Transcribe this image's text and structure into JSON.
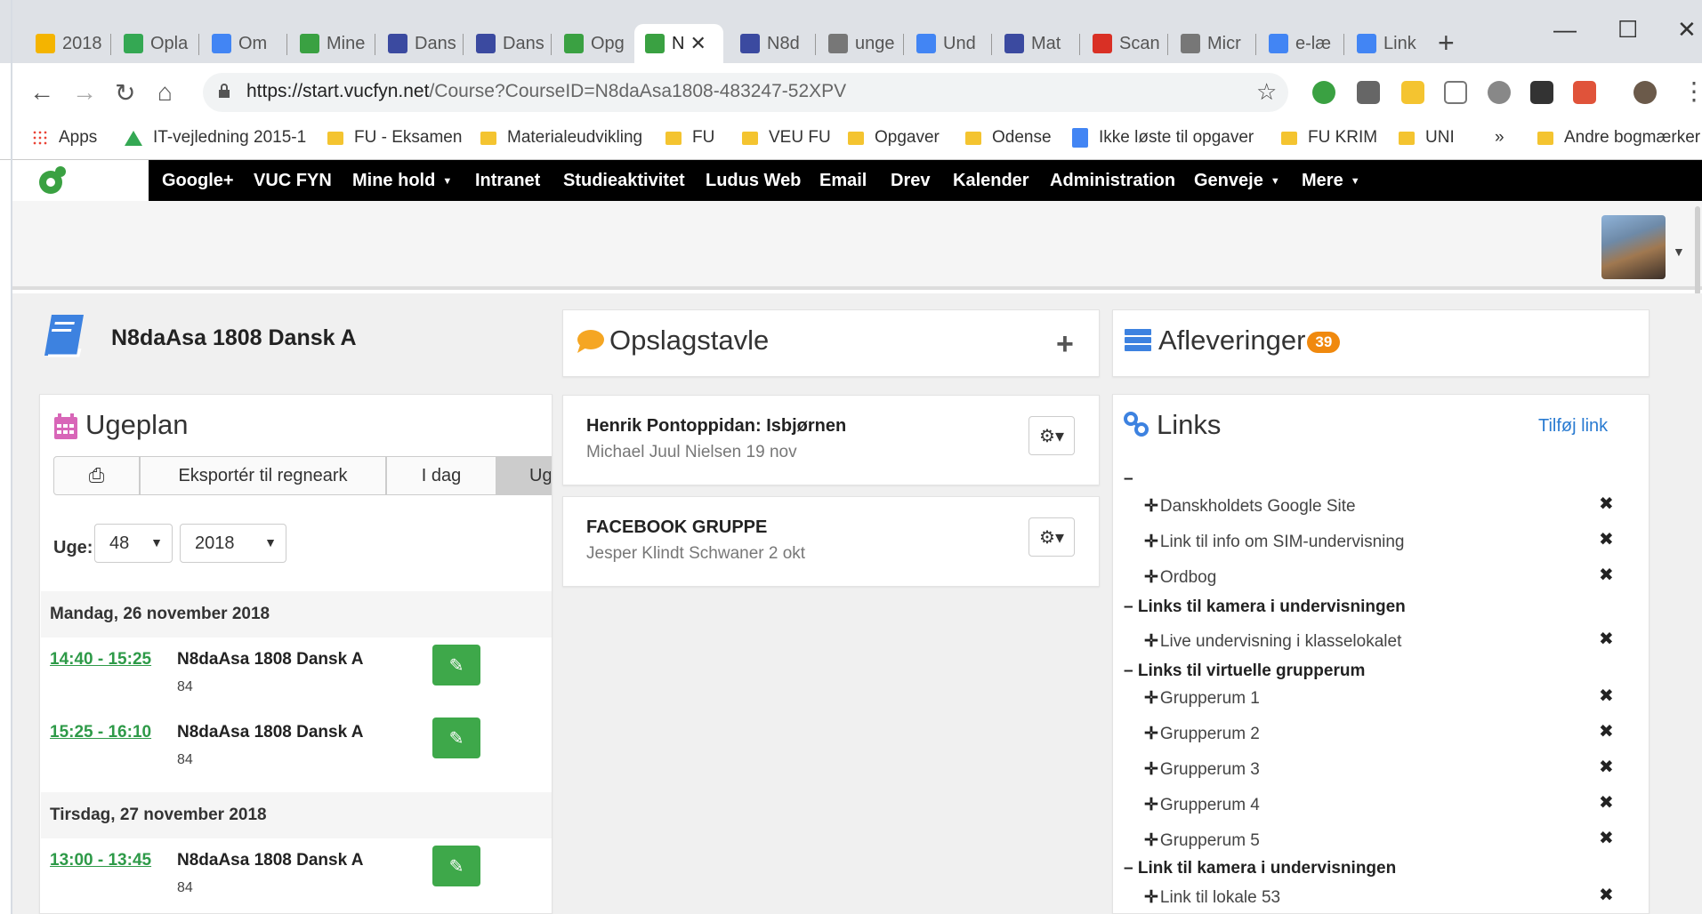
{
  "browser": {
    "tabs": [
      {
        "label": "2018",
        "color": "#f4b400"
      },
      {
        "label": "Opla",
        "color": "#34a853"
      },
      {
        "label": "Om ",
        "color": "#4285f4"
      },
      {
        "label": "Mine",
        "color": "#3aa142"
      },
      {
        "label": "Dans",
        "color": "#3b4aa0"
      },
      {
        "label": "Dans",
        "color": "#3b4aa0"
      },
      {
        "label": "Opg",
        "color": "#3aa142"
      },
      {
        "label": "N",
        "color": "#3aa142"
      },
      {
        "label": "N8d",
        "color": "#3b4aa0"
      },
      {
        "label": "unge",
        "color": "#777777"
      },
      {
        "label": "Und",
        "color": "#4285f4"
      },
      {
        "label": "Mat",
        "color": "#3b4aa0"
      },
      {
        "label": "Scan",
        "color": "#d93025"
      },
      {
        "label": "Micr",
        "color": "#777777"
      },
      {
        "label": "e-læ",
        "color": "#4285f4"
      },
      {
        "label": "Link",
        "color": "#4285f4"
      }
    ],
    "url_base": "https://start.vucfyn.net",
    "url_path": "/Course?CourseID=N8daAsa1808-483247-52XPV",
    "bookmarks": [
      "Apps",
      "IT-vejledning 2015-1",
      "FU - Eksamen",
      "Materialeudvikling",
      "FU",
      "VEU FU",
      "Opgaver",
      "Odense",
      "Ikke løste til opgaver",
      "FU KRIM",
      "UNI",
      "»",
      "Andre bogmærker"
    ]
  },
  "nav": {
    "items": [
      "Google+",
      "VUC FYN",
      "Mine hold",
      "Intranet",
      "Studieaktivitet",
      "Ludus Web",
      "Email",
      "Drev",
      "Kalender",
      "Administration",
      "Genveje",
      "Mere"
    ]
  },
  "course": {
    "title": "N8daAsa 1808 Dansk A"
  },
  "ugeplan": {
    "title": "Ugeplan",
    "buttons": {
      "export": "Eksportér til regneark",
      "today": "I dag",
      "week": "Ug"
    },
    "week_label": "Uge:",
    "week": "48",
    "year": "2018",
    "days": [
      {
        "date": "Mandag, 26 november 2018",
        "lessons": [
          {
            "time": "14:40 - 15:25",
            "name": "N8daAsa 1808 Dansk A",
            "room": "84"
          },
          {
            "time": "15:25 - 16:10",
            "name": "N8daAsa 1808 Dansk A",
            "room": "84"
          }
        ]
      },
      {
        "date": "Tirsdag, 27 november 2018",
        "lessons": [
          {
            "time": "13:00 - 13:45",
            "name": "N8daAsa 1808 Dansk A",
            "room": "84"
          }
        ]
      }
    ]
  },
  "opslagstavle": {
    "title": "Opslagstavle",
    "posts": [
      {
        "title": "Henrik Pontoppidan: Isbjørnen",
        "meta": "Michael Juul Nielsen  19 nov"
      },
      {
        "title": "FACEBOOK GRUPPE",
        "meta": "Jesper Klindt Schwaner  2 okt"
      }
    ]
  },
  "afleveringer": {
    "title": "Afleveringer",
    "count": "39"
  },
  "links": {
    "title": "Links",
    "add": "Tilføj link",
    "items": [
      {
        "kind": "group",
        "label": "–"
      },
      {
        "kind": "link",
        "label": "Danskholdets Google Site"
      },
      {
        "kind": "link",
        "label": "Link til info om SIM-undervisning"
      },
      {
        "kind": "link",
        "label": "Ordbog"
      },
      {
        "kind": "group",
        "label": "– Links til kamera i undervisningen"
      },
      {
        "kind": "link",
        "label": "Live undervisning i klasselokalet"
      },
      {
        "kind": "group",
        "label": "– Links til virtuelle grupperum"
      },
      {
        "kind": "link",
        "label": "Grupperum 1"
      },
      {
        "kind": "link",
        "label": "Grupperum 2"
      },
      {
        "kind": "link",
        "label": "Grupperum 3"
      },
      {
        "kind": "link",
        "label": "Grupperum 4"
      },
      {
        "kind": "link",
        "label": "Grupperum 5"
      },
      {
        "kind": "group",
        "label": "– Link til kamera i undervisningen"
      },
      {
        "kind": "link",
        "label": "Link til lokale 53"
      }
    ]
  }
}
